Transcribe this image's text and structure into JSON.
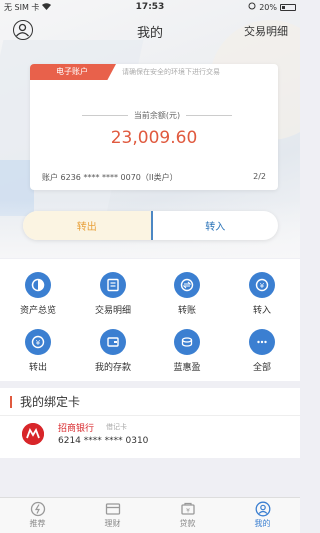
{
  "status_bar": {
    "carrier": "无 SIM 卡",
    "time": "17:53",
    "battery": "20%"
  },
  "nav": {
    "title": "我的",
    "right_action": "交易明细"
  },
  "account_card": {
    "tag": "电子账户",
    "tip": "请确保在安全的环境下进行交易",
    "balance_label": "当前余额(元)",
    "balance": "23,009.60",
    "account": "账户 6236 **** **** 0070（II类户）",
    "page": "2/2"
  },
  "transfer": {
    "out_label": "转出",
    "in_label": "转入"
  },
  "grid": [
    {
      "label": "资产总览",
      "icon": "pie-icon"
    },
    {
      "label": "交易明细",
      "icon": "list-icon"
    },
    {
      "label": "转账",
      "icon": "transfer-icon"
    },
    {
      "label": "转入",
      "icon": "transfer-in-icon"
    },
    {
      "label": "转出",
      "icon": "transfer-out-icon"
    },
    {
      "label": "我的存款",
      "icon": "wallet-icon"
    },
    {
      "label": "蓝惠盈",
      "icon": "coin-icon"
    },
    {
      "label": "全部",
      "icon": "more-icon"
    }
  ],
  "bound_cards": {
    "title": "我的绑定卡",
    "bank_name": "招商银行",
    "card_type": "借记卡",
    "card_number": "6214 **** **** 0310"
  },
  "tabs": [
    {
      "label": "推荐",
      "icon": "recommend-icon"
    },
    {
      "label": "理财",
      "icon": "finance-icon"
    },
    {
      "label": "贷款",
      "icon": "loan-icon"
    },
    {
      "label": "我的",
      "icon": "profile-icon",
      "active": true
    }
  ],
  "colors": {
    "accent_blue": "#3b7fd1",
    "accent_red": "#e05a3f",
    "orange": "#e8a13c"
  }
}
